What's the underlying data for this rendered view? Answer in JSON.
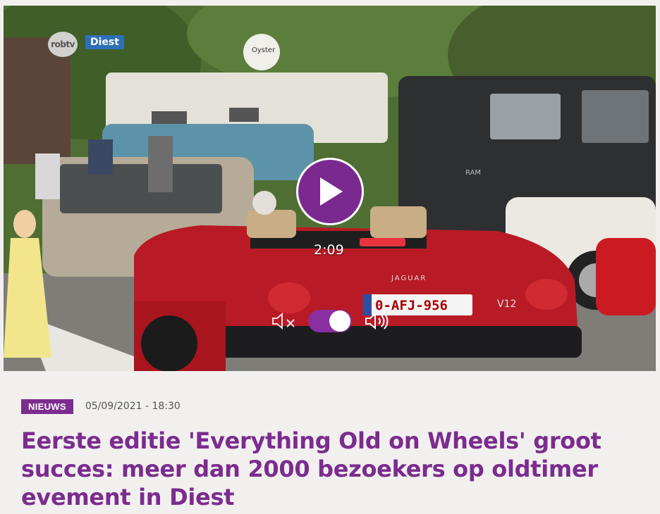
{
  "video": {
    "channel_logo": "robtv",
    "location_badge": "Diest",
    "duration": "2:09",
    "play_icon": "play-icon",
    "mute_icon": "volume-mute-icon",
    "speaker_icon": "volume-up-icon",
    "volume_on": true,
    "scene_text": {
      "satellite_label": "Oyster",
      "license_plate": "0-AFJ-956",
      "car_brand": "JAGUAR",
      "model_badge": "V12",
      "van_badge": "RAM"
    }
  },
  "article": {
    "category": "NIEUWS",
    "datetime": "05/09/2021 - 18:30",
    "title": "Eerste editie 'Everything Old on Wheels' groot succes: meer dan 2000 bezoekers op oldtimer evement in Diest"
  },
  "colors": {
    "accent": "#7b2c8e",
    "toggle": "#8a2fa0",
    "badge_blue": "#2f6fb8"
  }
}
